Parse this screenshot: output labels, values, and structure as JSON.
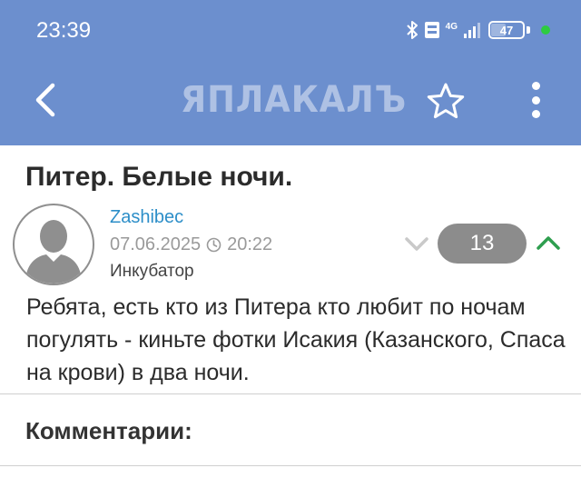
{
  "status_bar": {
    "time": "23:39",
    "battery": "47",
    "network": "4G",
    "icons": [
      "bluetooth-icon",
      "volte-icon",
      "signal-icon",
      "battery-icon"
    ]
  },
  "app_bar": {
    "logo": "ЯПЛАКАЛЪ",
    "back_icon": "chevron-left-icon",
    "favorite_icon": "star-outline-icon",
    "menu_icon": "more-vertical-icon"
  },
  "post": {
    "title": "Питер. Белые ночи.",
    "author": "Zashibec",
    "date": "07.06.2025",
    "time": "20:22",
    "rank": "Инкубатор",
    "rating": "13",
    "body": "Ребята, есть кто из Питера кто любит по ночам погулять - киньте фотки Исакия (Казанского, Спаса на крови) в два ночи."
  },
  "comments": {
    "heading": "Комментарии:"
  },
  "colors": {
    "header_bg": "#6c8fce",
    "author_link": "#2c8ec8",
    "vote_up": "#2e9e4f",
    "vote_pill": "#8c8c8c"
  }
}
